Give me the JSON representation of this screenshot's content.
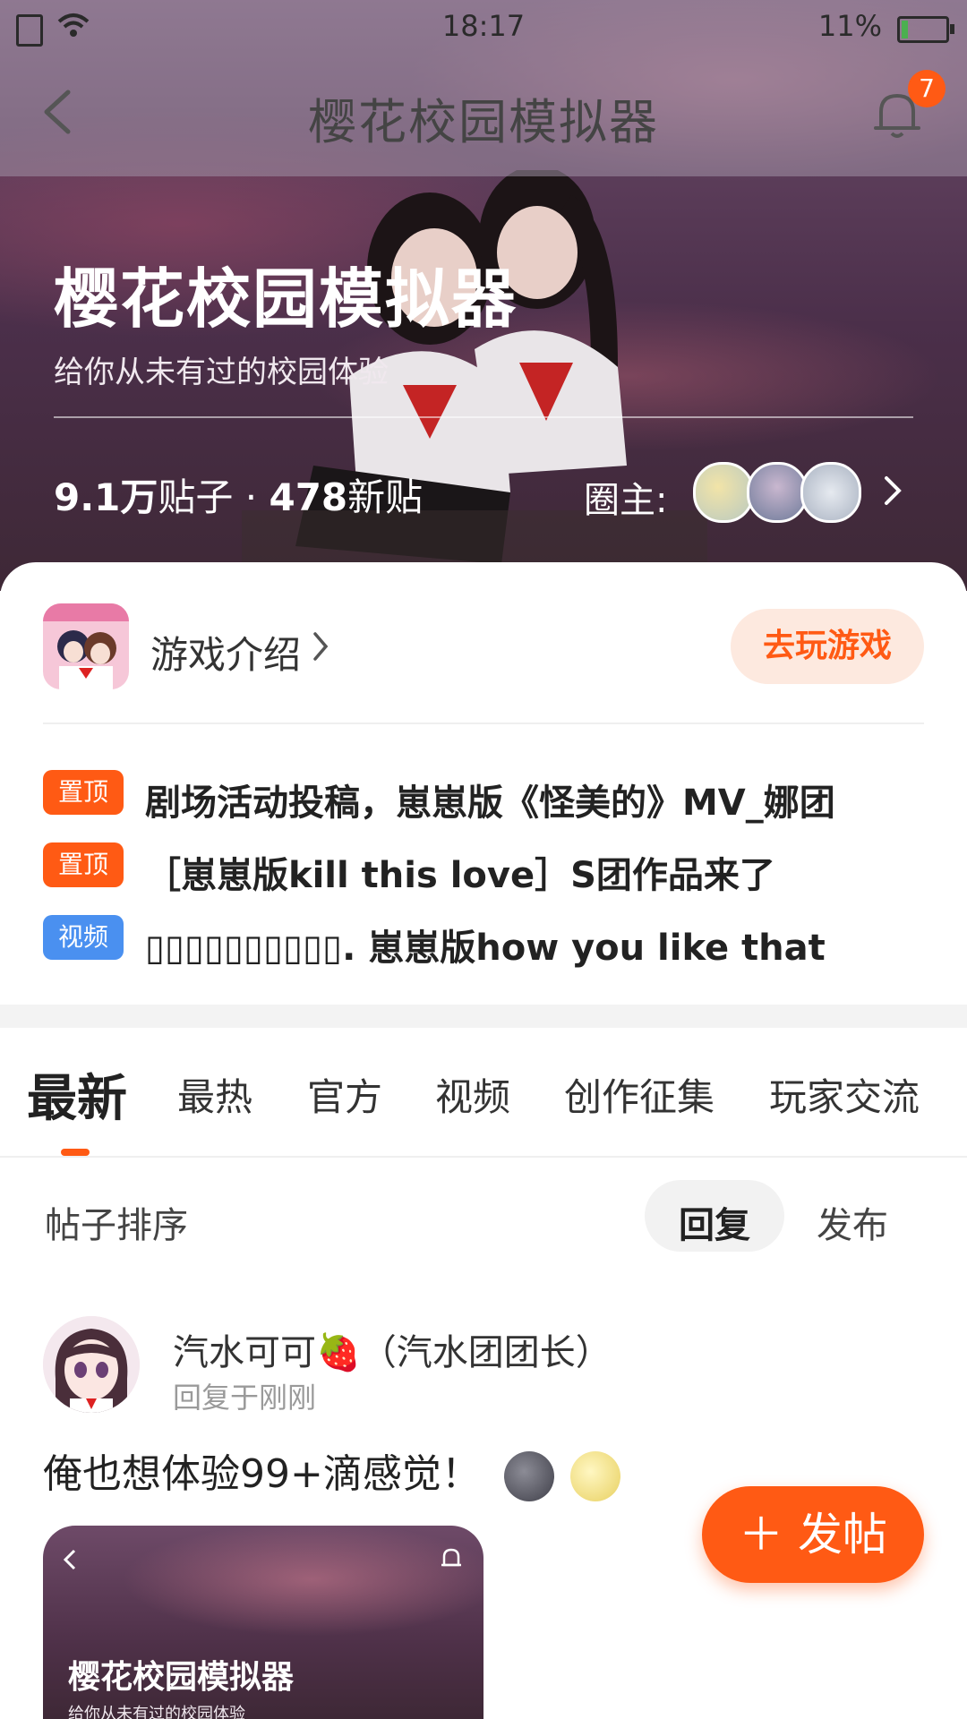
{
  "status_bar": {
    "time": "18:17",
    "battery": "11%"
  },
  "nav": {
    "title": "樱花校园模拟器",
    "notification_count": "7"
  },
  "hero": {
    "title": "樱花校园模拟器",
    "subtitle": "给你从未有过的校园体验",
    "posts_count": "9.1万",
    "posts_label": "贴子",
    "separator": " · ",
    "new_count": "478",
    "new_label": "新贴",
    "owner_label": "圈主:"
  },
  "game": {
    "intro_label": "游戏介绍",
    "play_button": "去玩游戏"
  },
  "pinned": [
    {
      "tag": "置顶",
      "tag_color": "#ff5a14",
      "text": "剧场活动投稿，崽崽版《怪美的》MV_娜团"
    },
    {
      "tag": "置顶",
      "tag_color": "#ff5a14",
      "text": "［崽崽版kill this love］S团作品来了"
    },
    {
      "tag": "视频",
      "tag_color": "#4a90f0",
      "text": "▯▯▯▯▯▯▯▯▯▯. 崽崽版how you like that"
    }
  ],
  "tabs": [
    "最新",
    "最热",
    "官方",
    "视频",
    "创作征集",
    "玩家交流"
  ],
  "sort": {
    "label": "帖子排序",
    "reply": "回复",
    "publish": "发布"
  },
  "post": {
    "author": "汽水可可🍓（汽水团团长）",
    "time": "回复于刚刚",
    "body": "俺也想体验99+滴感觉！",
    "thumb_title": "樱花校园模拟器",
    "thumb_sub": "给你从未有过的校园体验"
  },
  "fab": {
    "label": "＋ 发帖"
  },
  "colors": {
    "accent": "#ff5a14",
    "video_tag": "#4a90f0"
  }
}
